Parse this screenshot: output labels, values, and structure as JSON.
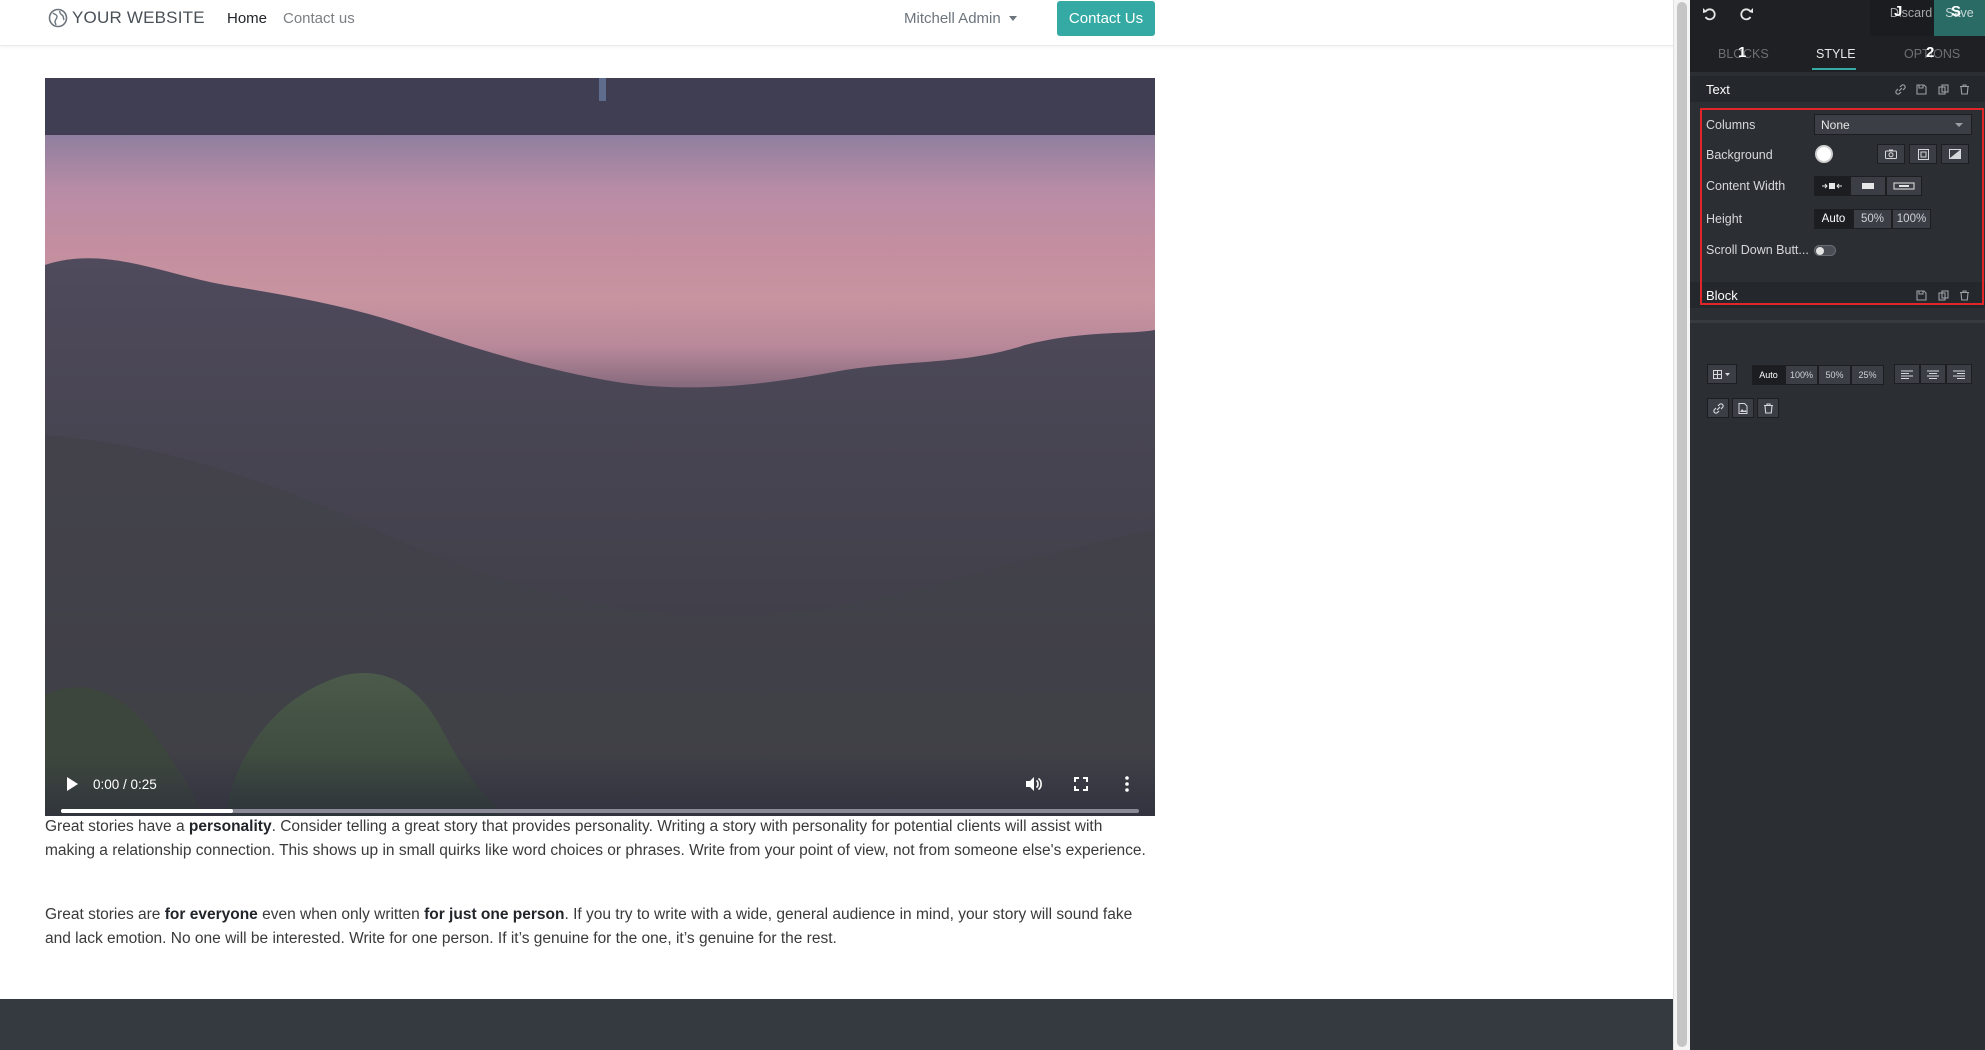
{
  "site": {
    "brand": "YOUR WEBSITE",
    "nav": {
      "home": "Home",
      "contact": "Contact us"
    },
    "user": "Mitchell Admin",
    "cta": "Contact Us",
    "video": {
      "time": "0:00 / 0:25",
      "progress_fraction": 0.16
    },
    "para1": {
      "pre": "Great stories have a ",
      "bold1": "personality",
      "post": ". Consider telling a great story that provides personality. Writing a story with personality for potential clients will assist with making a relationship connection. This shows up in small quirks like word choices or phrases. Write from your point of view, not from someone else's experience."
    },
    "para2": {
      "pre": "Great stories are ",
      "bold1": "for everyone",
      "mid": " even when only written ",
      "bold2": "for just one person",
      "post": ". If you try to write with a wide, general audience in mind, your story will sound fake and lack emotion. No one will be interested. Write for one person. If it’s genuine for the one, it’s genuine for the rest."
    }
  },
  "panel": {
    "discard": "Discard",
    "save": "Save",
    "overlay": {
      "n1": "1",
      "n2": "2",
      "n3": "J",
      "n4": "S"
    },
    "tabs": {
      "blocks": "BLOCKS",
      "style": "STYLE",
      "options": "OPTIONS"
    },
    "text_section": {
      "title": "Text",
      "columns_label": "Columns",
      "columns_value": "None",
      "background_label": "Background",
      "content_width_label": "Content Width",
      "height_label": "Height",
      "height_options": [
        "Auto",
        "50%",
        "100%"
      ],
      "scroll_label": "Scroll Down Butt..."
    },
    "block_section": {
      "title": "Block",
      "width_options": [
        "Auto",
        "100%",
        "50%",
        "25%"
      ]
    },
    "colors": {
      "accent": "#35a9a3",
      "highlight": "#e1262a",
      "panel_bg": "#2b2e33"
    }
  }
}
